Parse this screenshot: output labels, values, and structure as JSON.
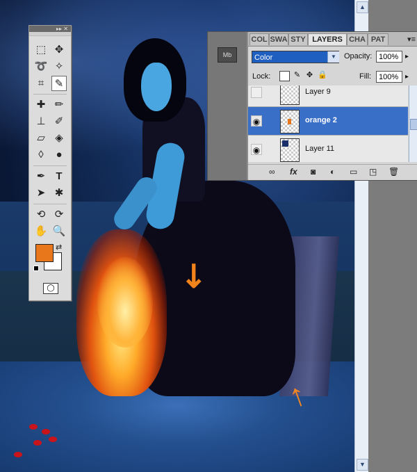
{
  "layers_panel": {
    "tabs": [
      "COL",
      "SWA",
      "STY",
      "LAYERS",
      "CHA",
      "PAT"
    ],
    "active_tab": "LAYERS",
    "mb_button": "Mb",
    "blend_mode": "Color",
    "opacity_label": "Opacity:",
    "opacity_value": "100%",
    "lock_label": "Lock:",
    "fill_label": "Fill:",
    "fill_value": "100%",
    "layers": [
      {
        "name": "Layer 9",
        "visible": false,
        "selected": false
      },
      {
        "name": "orange 2",
        "visible": true,
        "selected": true
      },
      {
        "name": "Layer 11",
        "visible": true,
        "selected": false
      }
    ],
    "footer_icons": [
      "link-icon",
      "fx-icon",
      "mask-icon",
      "adjustment-icon",
      "folder-icon",
      "new-layer-icon",
      "trash-icon"
    ]
  },
  "toolbox": {
    "foreground_color": "#e8771c",
    "background_color": "#ffffff",
    "active_tool": "eyedropper"
  },
  "colors": {
    "annotation_arrow": "#ff8a1c",
    "selection_blue": "#3a6fc8"
  }
}
